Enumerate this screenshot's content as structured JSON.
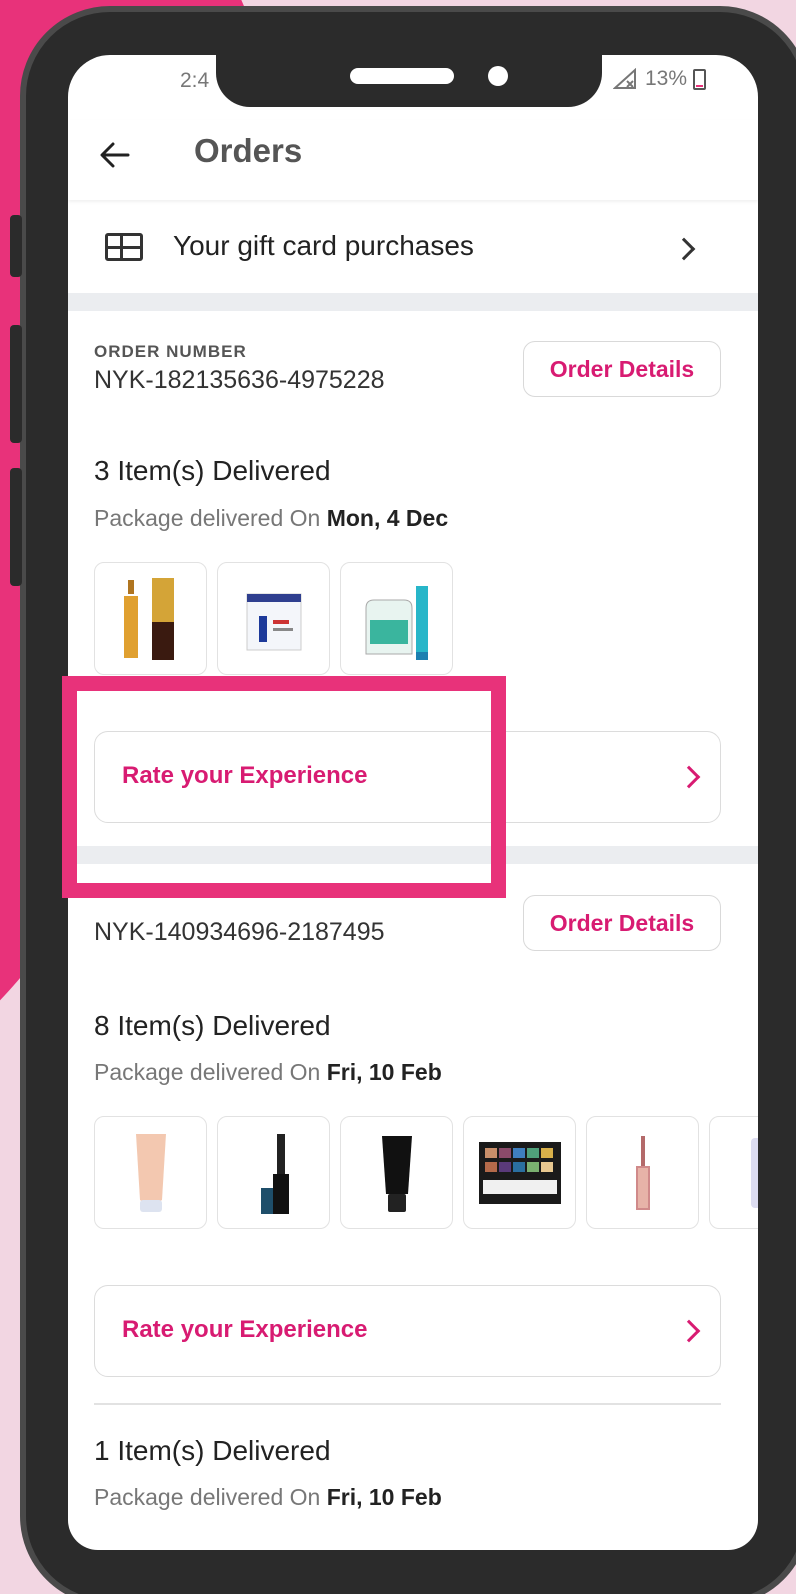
{
  "status_bar": {
    "time": "2:4",
    "battery": "13%"
  },
  "header": {
    "title": "Orders"
  },
  "gift_card": {
    "label": "Your gift card purchases"
  },
  "orders": [
    {
      "order_label": "ORDER NUMBER",
      "order_number": "NYK-182135636-4975228",
      "details_label": "Order Details",
      "delivered_title": "3 Item(s) Delivered",
      "delivered_prefix": "Package delivered On",
      "delivered_date": "Mon, 4 Dec",
      "rate_label": "Rate your Experience",
      "products": [
        "hair-serum",
        "moisturizer-box",
        "face-wash"
      ]
    },
    {
      "order_number": "NYK-140934696-2187495",
      "details_label": "Order Details",
      "delivered_title": "8 Item(s) Delivered",
      "delivered_prefix": "Package delivered On",
      "delivered_date": "Fri, 10 Feb",
      "rate_label": "Rate your Experience",
      "products": [
        "cream-tube",
        "eyeliner",
        "black-tube",
        "eyeshadow-palette",
        "lip-gloss",
        "partial-item"
      ]
    },
    {
      "delivered_title": "1 Item(s) Delivered",
      "delivered_prefix": "Package delivered On",
      "delivered_date": "Fri, 10 Feb"
    }
  ],
  "colors": {
    "accent": "#d81b72",
    "highlight": "#e8327a",
    "background": "#f2d6e2"
  }
}
